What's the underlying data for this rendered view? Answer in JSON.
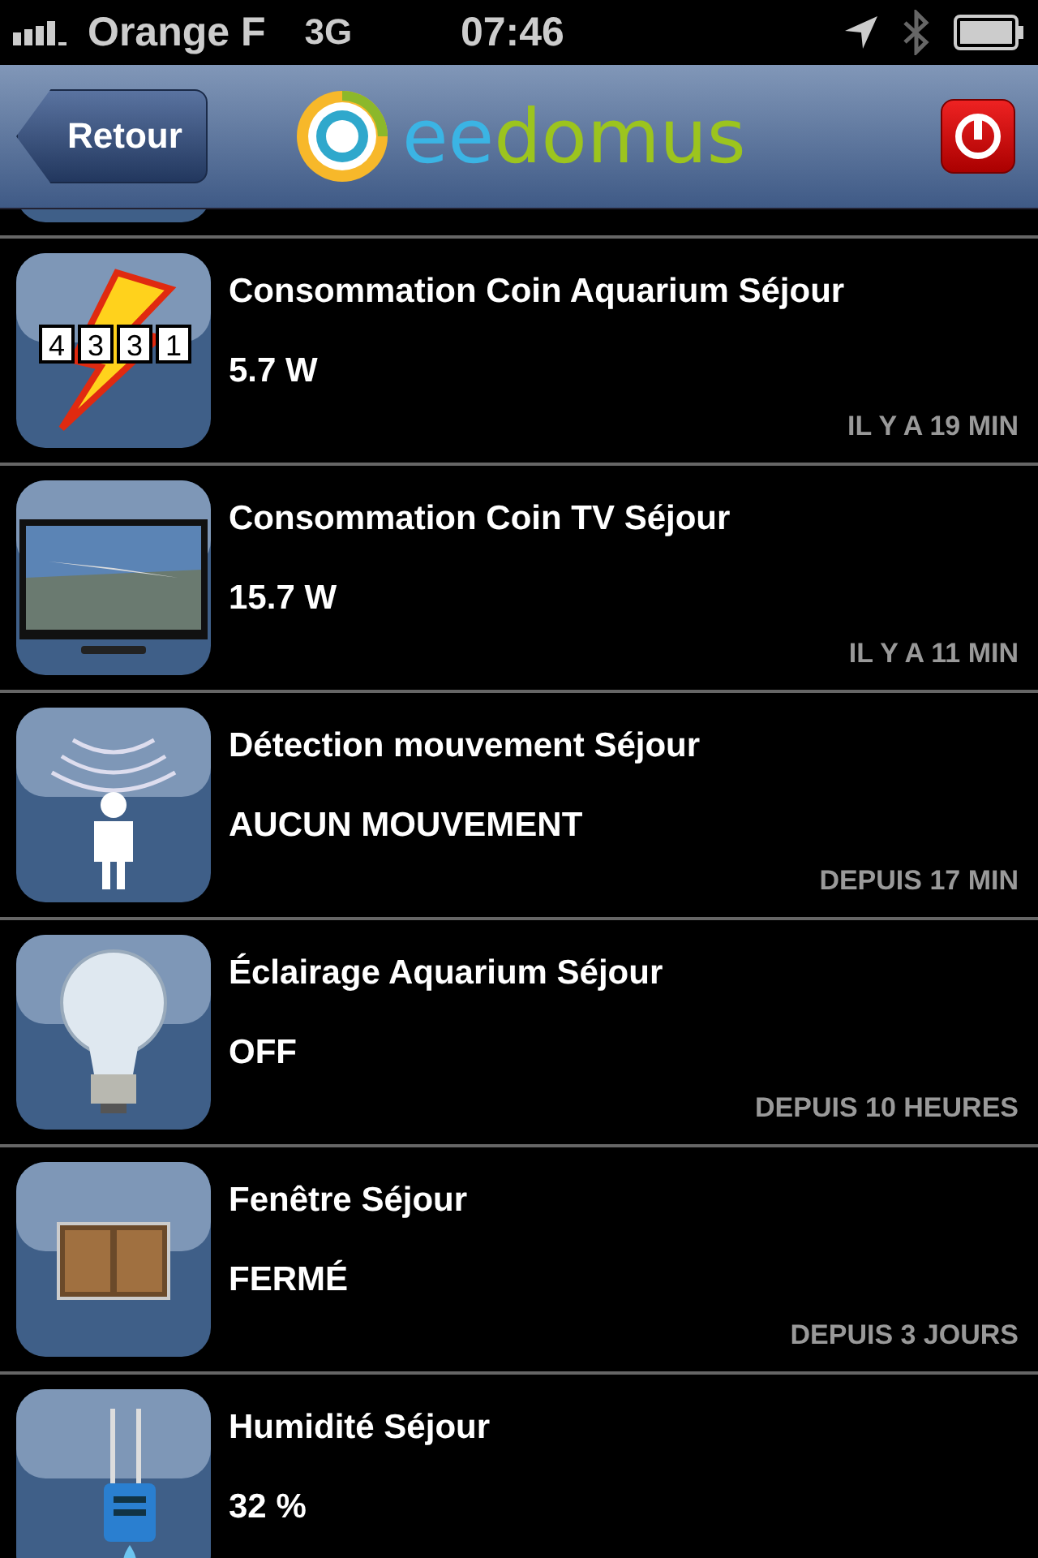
{
  "status_bar": {
    "carrier": "Orange F",
    "network": "3G",
    "time": "07:46"
  },
  "header": {
    "back_button": "Retour",
    "logo": {
      "prefix": "ee",
      "suffix": "domus"
    }
  },
  "devices": [
    {
      "kind": "meter",
      "meter_digits": [
        "4",
        "3",
        "3",
        "1"
      ],
      "name": "Consommation Coin Aquarium Séjour",
      "value": "5.7 W",
      "updated": "IL Y A 19 MIN"
    },
    {
      "kind": "tv",
      "name": "Consommation Coin TV Séjour",
      "value": "15.7 W",
      "updated": "IL Y A 11 MIN"
    },
    {
      "kind": "motion",
      "name": "Détection mouvement Séjour",
      "value": "AUCUN MOUVEMENT",
      "updated": "DEPUIS 17 MIN"
    },
    {
      "kind": "bulb",
      "name": "Éclairage Aquarium Séjour",
      "value": "OFF",
      "updated": "DEPUIS 10 HEURES"
    },
    {
      "kind": "window",
      "name": "Fenêtre Séjour",
      "value": "FERMÉ",
      "updated": "DEPUIS 3 JOURS"
    },
    {
      "kind": "humidity",
      "name": "Humidité Séjour",
      "value": "32 %"
    }
  ]
}
